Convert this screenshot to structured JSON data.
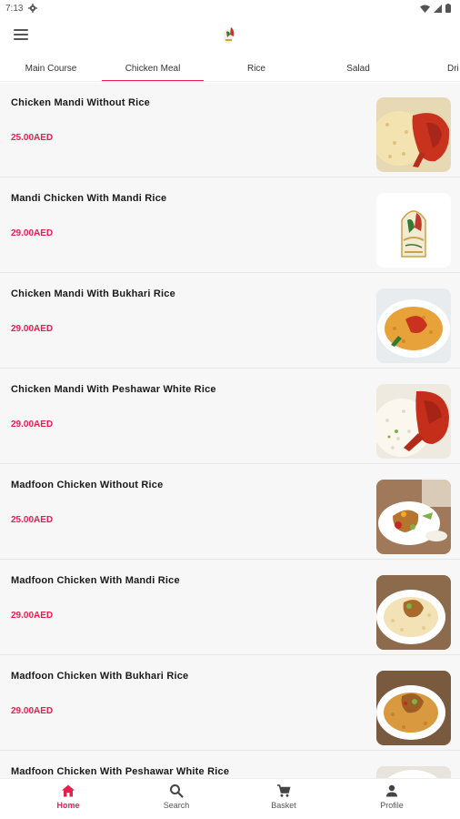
{
  "status_bar": {
    "time": "7:13"
  },
  "colors": {
    "accent": "#e91e4f",
    "text": "#1a1a1a",
    "list_bg": "#f7f7f7"
  },
  "tabs": [
    {
      "label": "Main Course"
    },
    {
      "label": "Chicken Meal"
    },
    {
      "label": "Rice"
    },
    {
      "label": "Salad"
    },
    {
      "label": "Dri"
    }
  ],
  "active_tab": "Chicken Meal",
  "items": [
    {
      "name": "Chicken Mandi Without Rice",
      "price": "25.00AED",
      "image_icon": "chicken-rice-photo"
    },
    {
      "name": "Mandi Chicken With Mandi Rice",
      "price": "29.00AED",
      "image_icon": "restaurant-logo"
    },
    {
      "name": "Chicken Mandi With Bukhari Rice",
      "price": "29.00AED",
      "image_icon": "bukhari-rice-photo"
    },
    {
      "name": "Chicken Mandi With Peshawar White Rice",
      "price": "29.00AED",
      "image_icon": "white-rice-chicken-photo"
    },
    {
      "name": "Madfoon Chicken Without Rice",
      "price": "25.00AED",
      "image_icon": "madfoon-plate-photo"
    },
    {
      "name": "Madfoon Chicken With Mandi Rice",
      "price": "29.00AED",
      "image_icon": "madfoon-rice-photo"
    },
    {
      "name": "Madfoon Chicken With Bukhari Rice",
      "price": "29.00AED",
      "image_icon": "madfoon-bukhari-photo"
    },
    {
      "name": "Madfoon Chicken With Peshawar White Rice",
      "price": "",
      "image_icon": "madfoon-white-rice-photo"
    }
  ],
  "bottom_nav": [
    {
      "label": "Home",
      "icon": "home-icon"
    },
    {
      "label": "Search",
      "icon": "search-icon"
    },
    {
      "label": "Basket",
      "icon": "cart-icon"
    },
    {
      "label": "Profile",
      "icon": "profile-icon"
    }
  ]
}
